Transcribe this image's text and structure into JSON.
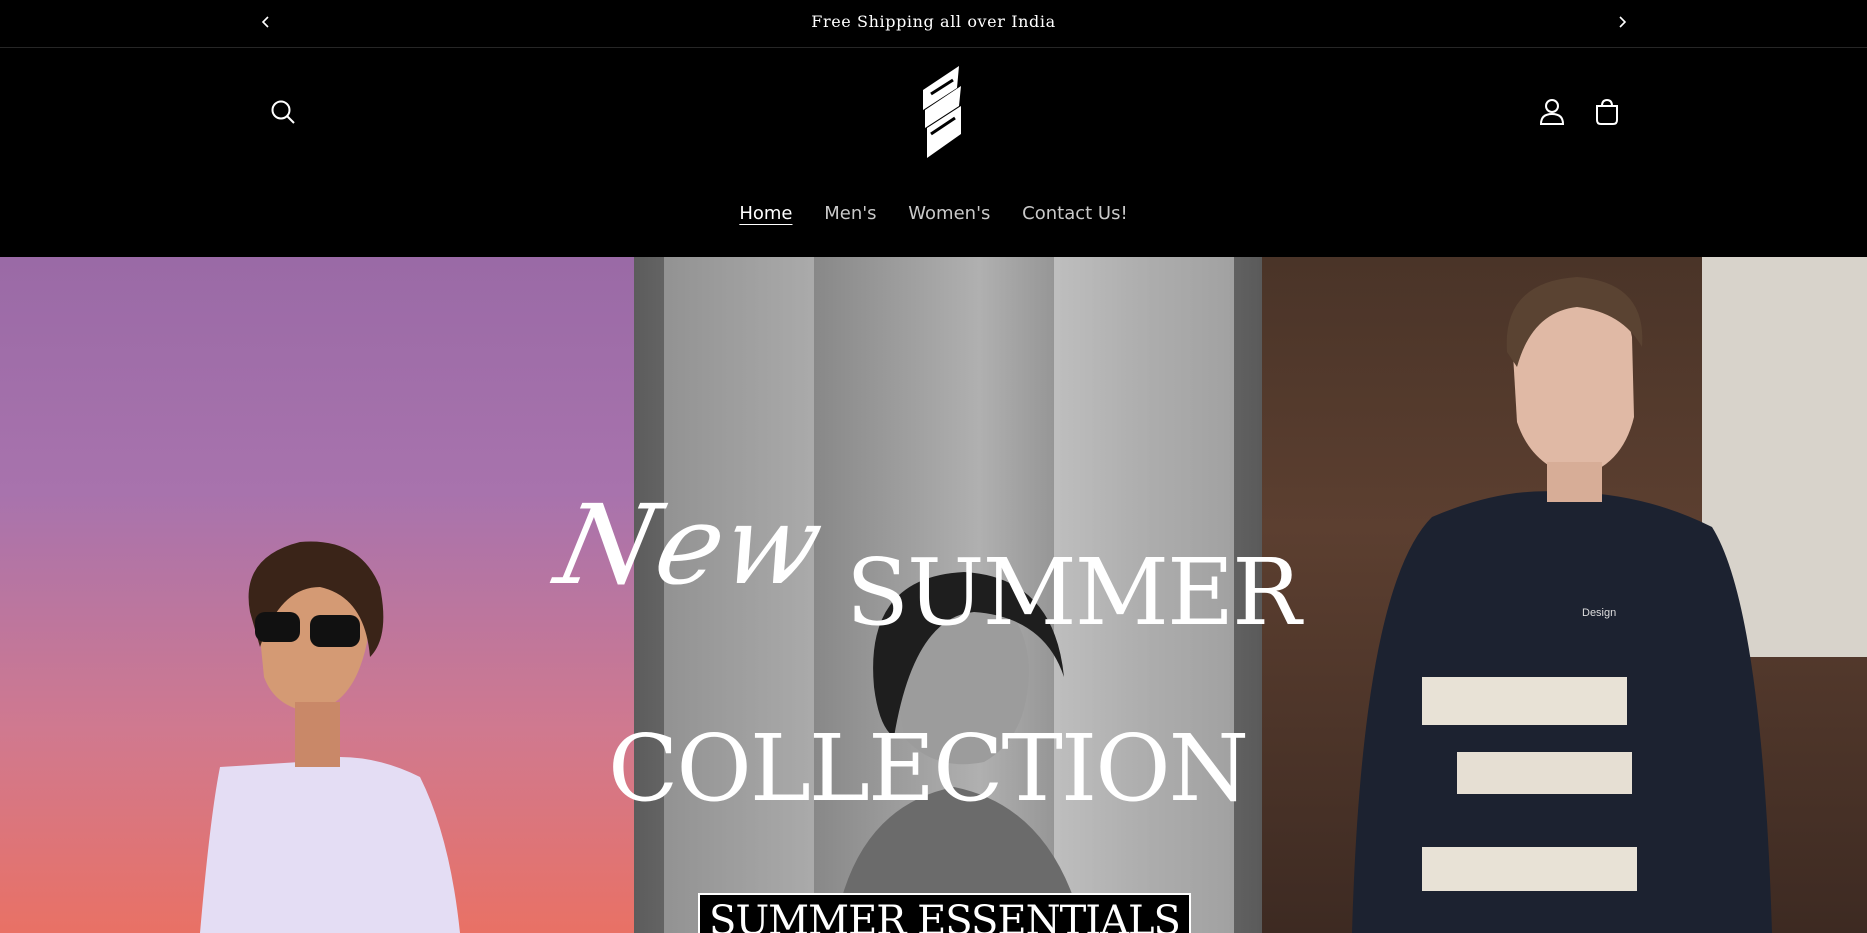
{
  "announcement": {
    "text": "Free Shipping all over India",
    "prev_icon": "chevron-left-icon",
    "next_icon": "chevron-right-icon"
  },
  "header": {
    "search_icon": "search-icon",
    "logo_icon": "brand-logo",
    "account_icon": "user-icon",
    "cart_icon": "cart-icon"
  },
  "nav": {
    "items": [
      {
        "label": "Home",
        "active": true
      },
      {
        "label": "Men's",
        "active": false
      },
      {
        "label": "Women's",
        "active": false
      },
      {
        "label": "Contact Us!",
        "active": false
      }
    ]
  },
  "hero": {
    "script_word": "New",
    "title_line1": "SUMMER",
    "title_line2": "COLLECTION",
    "badge": "SUMMER ESSENTIALS",
    "shirt_text": "Design"
  }
}
